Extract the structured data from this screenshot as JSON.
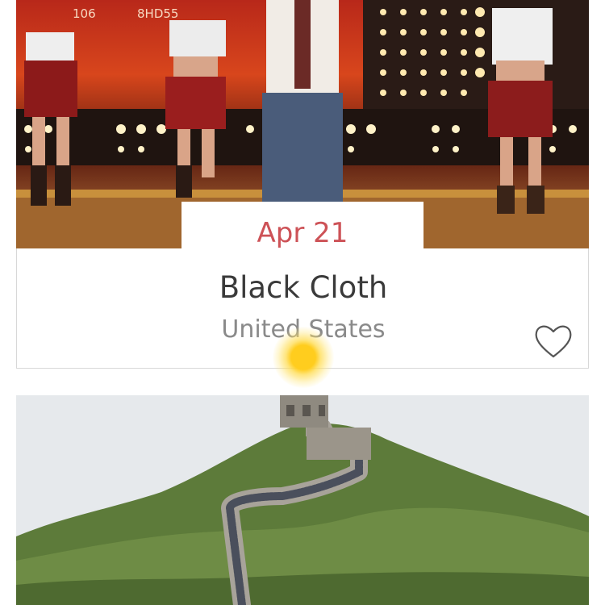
{
  "events": [
    {
      "date": "Apr 21",
      "title": "Black Cloth",
      "location": "United States",
      "photo_icon": "concert-stage-photo",
      "favorite_icon": "heart-outline-icon"
    },
    {
      "photo_icon": "great-wall-photo"
    }
  ],
  "colors": {
    "accent_date": "#cd5257",
    "title": "#3a3a3a",
    "subtitle": "#8a8a8a",
    "card_border": "#d8d8d8"
  }
}
